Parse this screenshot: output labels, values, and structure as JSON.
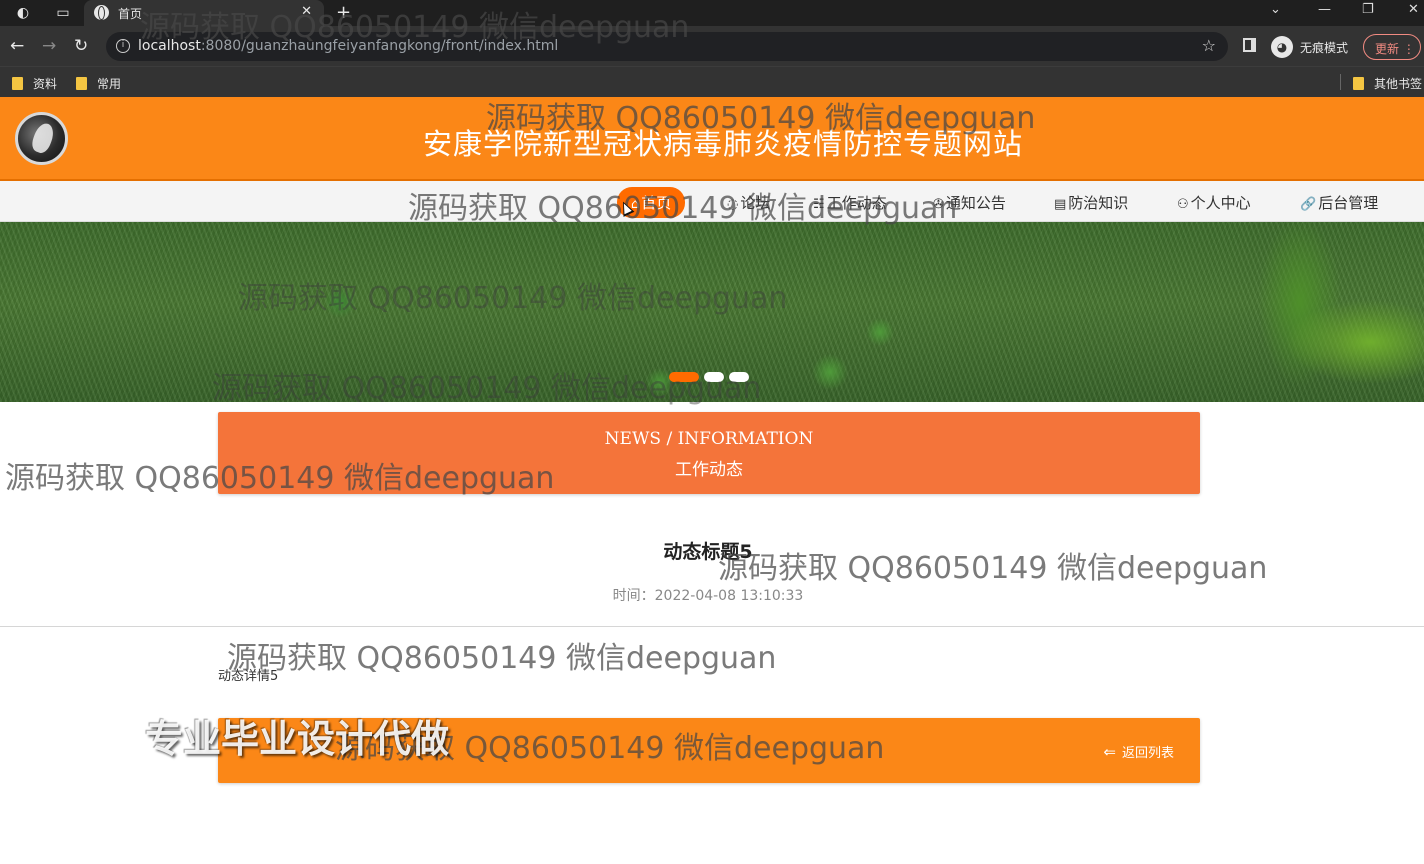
{
  "browser": {
    "tab_title": "首页",
    "url_host": "localhost",
    "url_path": ":8080/guanzhaungfeiyanfangkong/front/index.html",
    "incognito_label": "无痕模式",
    "update_label": "更新",
    "bookmarks": [
      "资料",
      "常用"
    ],
    "other_bookmarks": "其他书签"
  },
  "site": {
    "title": "安康学院新型冠状病毒肺炎疫情防控专题网站"
  },
  "nav": {
    "items": [
      {
        "label": "首页",
        "icon": "home-icon",
        "glyph": "⌂"
      },
      {
        "label": "论坛",
        "icon": "chat-icon",
        "glyph": "◌"
      },
      {
        "label": "工作动态",
        "icon": "news-icon",
        "glyph": "☷"
      },
      {
        "label": "通知公告",
        "icon": "bell-icon",
        "glyph": "✇"
      },
      {
        "label": "防治知识",
        "icon": "book-icon",
        "glyph": "▤"
      },
      {
        "label": "个人中心",
        "icon": "user-icon",
        "glyph": "⚇"
      },
      {
        "label": "后台管理",
        "icon": "link-icon",
        "glyph": "🔗"
      }
    ],
    "active_index": 0
  },
  "section": {
    "en": "NEWS / INFORMATION",
    "zh": "工作动态"
  },
  "article": {
    "title": "动态标题5",
    "time": "时间：2022-04-08 13:10:33",
    "body": "动态详情5"
  },
  "footer": {
    "back_label": "返回列表"
  },
  "overlays": {
    "watermark": "源码获取 QQ86050149 微信deepguan",
    "promo": "专业毕业设计代做"
  },
  "colors": {
    "header_orange": "#fb8717",
    "section_orange": "#f4743a",
    "active_nav": "#ff6b00"
  }
}
